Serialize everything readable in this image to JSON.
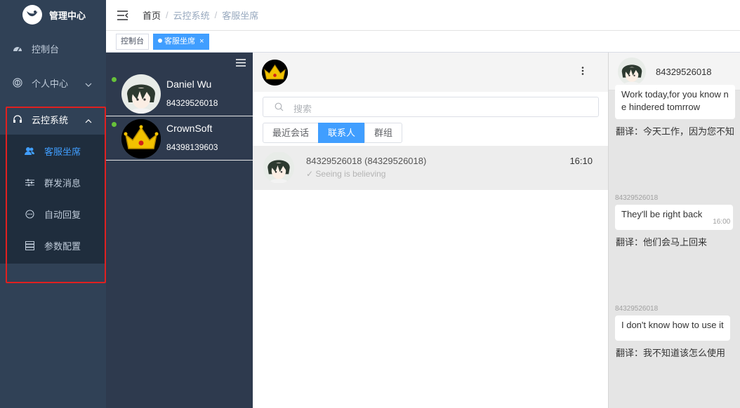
{
  "app": {
    "title": "管理中心"
  },
  "sidebar": {
    "items": [
      {
        "label": "控制台",
        "icon": "dashboard-icon"
      },
      {
        "label": "个人中心",
        "icon": "fingerprint-icon"
      },
      {
        "label": "云控系统",
        "icon": "headset-icon"
      }
    ],
    "subitems": [
      {
        "label": "客服坐席",
        "icon": "users-icon",
        "active": true
      },
      {
        "label": "群发消息",
        "icon": "sliders-icon"
      },
      {
        "label": "自动回复",
        "icon": "chat-bubble-icon"
      },
      {
        "label": "参数配置",
        "icon": "server-icon"
      }
    ]
  },
  "breadcrumb": {
    "home": "首页",
    "section": "云控系统",
    "page": "客服坐席"
  },
  "tags": [
    {
      "label": "控制台"
    },
    {
      "label": "客服坐席",
      "active": true,
      "close": "×"
    }
  ],
  "accounts": [
    {
      "name": "Daniel Wu",
      "number": "84329526018",
      "online": true
    },
    {
      "name": "CrownSoft",
      "number": "84398139603",
      "online": true
    }
  ],
  "middle": {
    "search_placeholder": "搜索",
    "tabs": [
      "最近会话",
      "联系人",
      "群组"
    ],
    "active_tab": "联系人",
    "contact": {
      "name": "84329526018 (84329526018)",
      "last_message": "✓ Seeing is believing",
      "time": "16:10"
    }
  },
  "chat": {
    "header_name": "84329526018",
    "messages": [
      {
        "text1": "Work today,for you know n",
        "text2": "e hindered tomrrow",
        "translation": "翻译：今天工作，因为您不知"
      },
      {
        "sender": "84329526018",
        "text": "They'll be right back",
        "time": "16:00",
        "translation": "翻译：他们会马上回来"
      },
      {
        "sender": "84329526018",
        "text": "I don't know how to use it",
        "translation": "翻译：我不知道该怎么使用"
      }
    ]
  },
  "colors": {
    "sidebar": "#304156",
    "submenu": "#1f2d3d",
    "accent": "#409eff",
    "online": "#67c23a",
    "highlight_box": "#e02020"
  }
}
